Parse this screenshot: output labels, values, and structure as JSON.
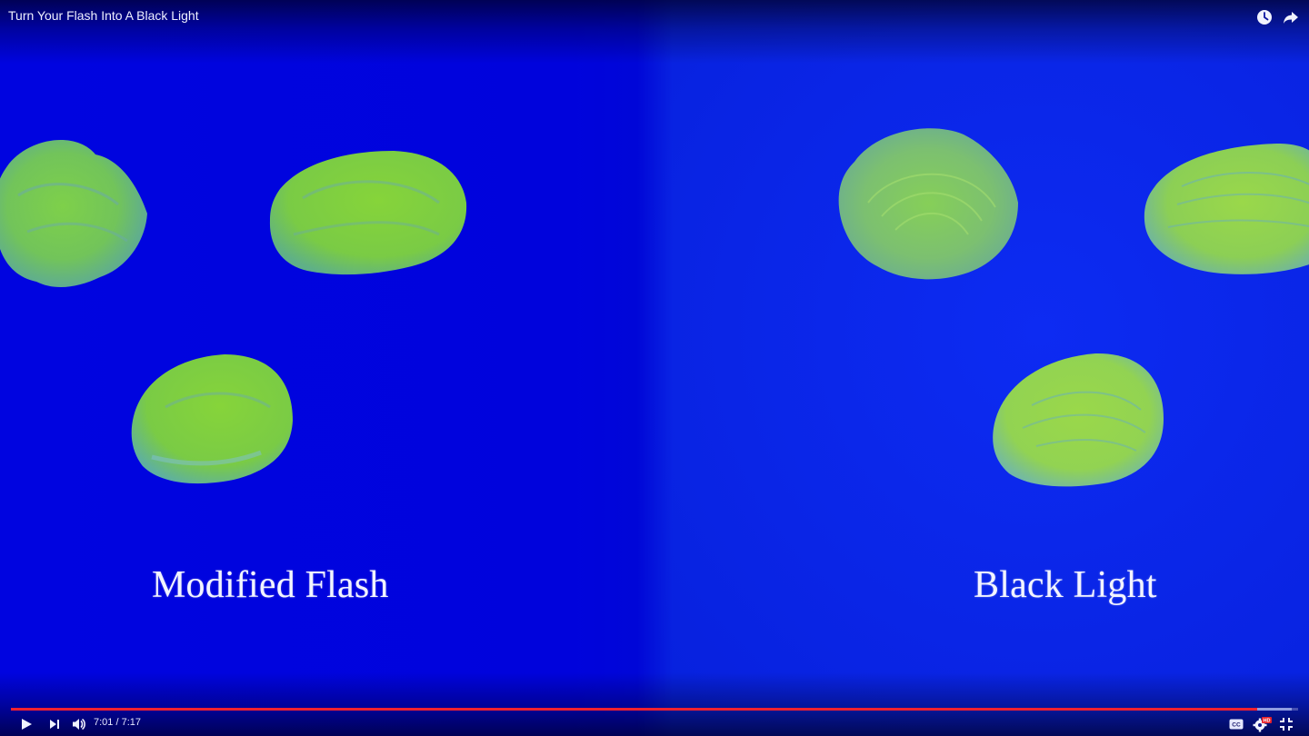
{
  "player": {
    "title": "Turn Your Flash Into A Black Light",
    "current_time": "7:01",
    "duration": "7:17",
    "time_display": "7:01 / 7:17",
    "progress_played_fraction": 0.968,
    "progress_loaded_fraction": 0.995,
    "quality_badge": "HD",
    "cc_label": "CC",
    "colors": {
      "accent": "#f0212f",
      "background_blue": "#0004e0",
      "paint_green": "#8ee23a",
      "hd_badge": "#e8202a"
    },
    "icons": {
      "watch_later": "clock-icon",
      "share": "share-arrow-icon",
      "play": "play-icon",
      "next": "skip-next-icon",
      "volume": "volume-icon",
      "captions": "cc-icon",
      "settings": "gear-icon",
      "exit_fullscreen": "exit-fullscreen-icon"
    }
  },
  "video_frame": {
    "left_caption": "Modified Flash",
    "right_caption": "Black Light"
  }
}
